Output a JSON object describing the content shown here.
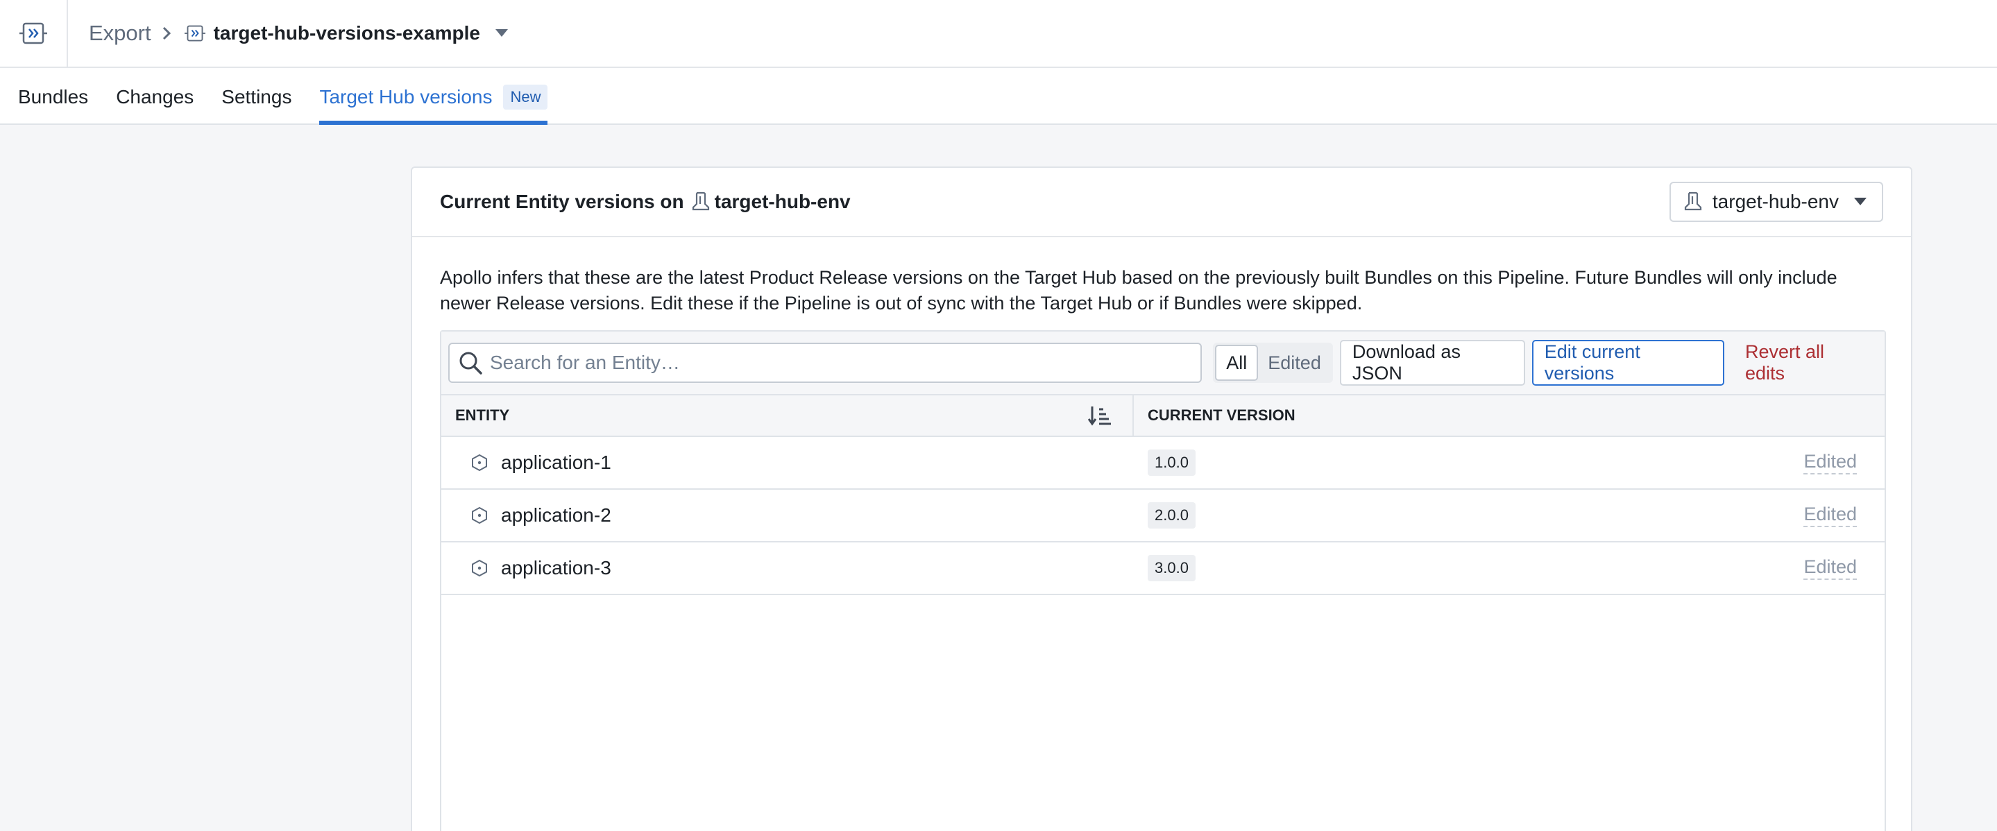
{
  "header": {
    "breadcrumb_parent": "Export",
    "breadcrumb_current": "target-hub-versions-example"
  },
  "tabs": [
    {
      "label": "Bundles"
    },
    {
      "label": "Changes"
    },
    {
      "label": "Settings"
    },
    {
      "label": "Target Hub versions",
      "badge": "New",
      "active": true
    }
  ],
  "panel": {
    "title_prefix": "Current Entity versions on",
    "title_env": "target-hub-env",
    "env_select_value": "target-hub-env",
    "description": "Apollo infers that these are the latest Product Release versions on the Target Hub based on the previously built Bundles on this Pipeline. Future Bundles will only include newer Release versions. Edit these if the Pipeline is out of sync with the Target Hub or if Bundles were skipped."
  },
  "toolbar": {
    "search_placeholder": "Search for an Entity…",
    "filter_all": "All",
    "filter_edited": "Edited",
    "download_label": "Download as JSON",
    "edit_label": "Edit current versions",
    "revert_label": "Revert all edits"
  },
  "table": {
    "col_entity": "ENTITY",
    "col_version": "CURRENT VERSION",
    "rows": [
      {
        "entity": "application-1",
        "version": "1.0.0",
        "status": "Edited"
      },
      {
        "entity": "application-2",
        "version": "2.0.0",
        "status": "Edited"
      },
      {
        "entity": "application-3",
        "version": "3.0.0",
        "status": "Edited"
      }
    ]
  },
  "colors": {
    "accent": "#2d72d2",
    "danger": "#ac2f33",
    "muted": "#8f99a8"
  }
}
